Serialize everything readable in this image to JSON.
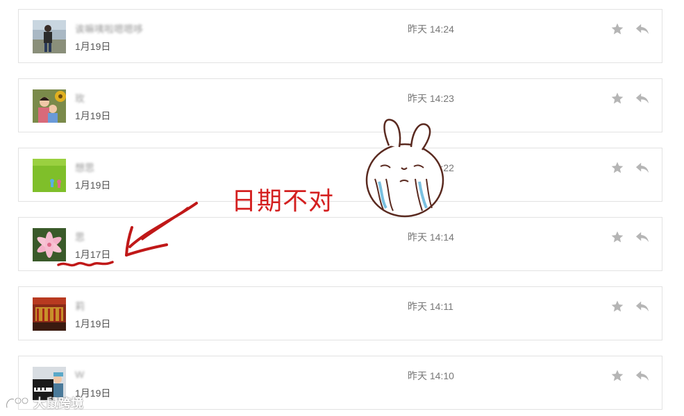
{
  "messages": [
    {
      "sender": "诶嘛咦啦嗯嗯哆",
      "date": "1月19日",
      "time": "昨天 14:24",
      "avatar": "person-outdoor-avatar"
    },
    {
      "sender": "玫",
      "date": "1月19日",
      "time": "昨天 14:23",
      "avatar": "children-sunflower-avatar"
    },
    {
      "sender": "想思",
      "date": "1月19日",
      "time": "昨天 14:22",
      "avatar": "grass-field-avatar"
    },
    {
      "sender": "思",
      "date": "1月17日",
      "time": "昨天 14:14",
      "avatar": "lily-flower-avatar"
    },
    {
      "sender": "莉",
      "date": "1月19日",
      "time": "昨天 14:11",
      "avatar": "red-stage-avatar"
    },
    {
      "sender": "W",
      "date": "1月19日",
      "time": "昨天 14:10",
      "avatar": "piano-child-avatar"
    }
  ],
  "annotation": {
    "text": "日期不对",
    "color": "#d42020"
  },
  "watermark": {
    "text": "大鼠跨境"
  },
  "icons": {
    "favorite": "star-icon",
    "reply": "reply-arrow-icon",
    "sticker": "crying-rabbit-sticker"
  },
  "colors": {
    "border": "#e2e2e2",
    "icon": "#b5b5b5",
    "annotation": "#d42020"
  }
}
